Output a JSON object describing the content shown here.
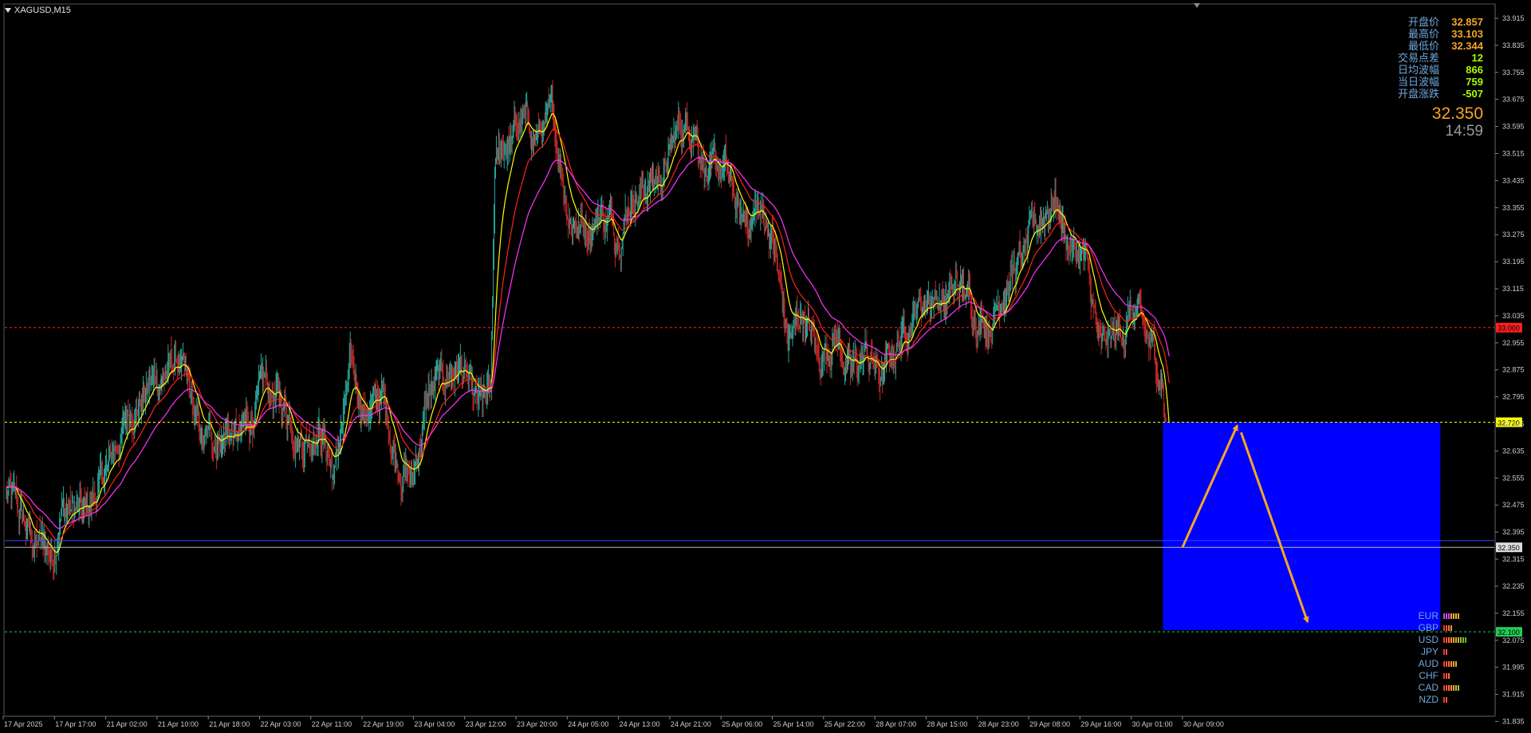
{
  "window": {
    "symbol_label": "XAGUSD,M15"
  },
  "info_panel": {
    "rows": [
      {
        "label": "开盘价",
        "value": "32.857",
        "color": "#f5a623"
      },
      {
        "label": "最高价",
        "value": "33.103",
        "color": "#f5a623"
      },
      {
        "label": "最低价",
        "value": "32.344",
        "color": "#f5a623"
      },
      {
        "label": "交易点差",
        "value": "12",
        "color": "#aaff00"
      },
      {
        "label": "日均波幅",
        "value": "866",
        "color": "#aaff00"
      },
      {
        "label": "当日波幅",
        "value": "759",
        "color": "#aaff00"
      },
      {
        "label": "开盘涨跌",
        "value": "-507",
        "color": "#aaff00"
      }
    ],
    "current_price": "32.350",
    "bar_timer": "14:59"
  },
  "currency_strength": [
    {
      "currency": "EUR",
      "level": 7,
      "max": 10
    },
    {
      "currency": "GBP",
      "level": 4,
      "max": 10
    },
    {
      "currency": "USD",
      "level": 10,
      "max": 10
    },
    {
      "currency": "JPY",
      "level": 2,
      "max": 10
    },
    {
      "currency": "AUD",
      "level": 6,
      "max": 10
    },
    {
      "currency": "CHF",
      "level": 3,
      "max": 10
    },
    {
      "currency": "CAD",
      "level": 7,
      "max": 10
    },
    {
      "currency": "NZD",
      "level": 2,
      "max": 10
    }
  ],
  "colors": {
    "background": "#000000",
    "bull": "#26a69a",
    "bear": "#c62828",
    "ma_fast": "#ffff00",
    "ma_mid": "#ff2020",
    "ma_slow": "#ff33ff",
    "zone": "#0000ff",
    "arrow": "#f5a623",
    "grid_text": "#cccccc"
  },
  "chart_data": {
    "type": "candlestick",
    "symbol": "XAGUSD",
    "timeframe": "M15",
    "ylim": [
      31.855,
      33.955
    ],
    "y_ticks": [
      "33.915",
      "33.835",
      "33.755",
      "33.675",
      "33.595",
      "33.515",
      "33.435",
      "33.355",
      "33.275",
      "33.195",
      "33.115",
      "33.035",
      "32.955",
      "32.875",
      "32.795",
      "32.715",
      "32.635",
      "32.555",
      "32.475",
      "32.395",
      "32.315",
      "32.235",
      "32.155",
      "32.075",
      "31.995",
      "31.915",
      "31.835"
    ],
    "x_ticks": [
      "17 Apr 2025",
      "17 Apr 17:00",
      "21 Apr 02:00",
      "21 Apr 10:00",
      "21 Apr 18:00",
      "22 Apr 03:00",
      "22 Apr 11:00",
      "22 Apr 19:00",
      "23 Apr 04:00",
      "23 Apr 12:00",
      "23 Apr 20:00",
      "24 Apr 05:00",
      "24 Apr 13:00",
      "24 Apr 21:00",
      "25 Apr 06:00",
      "25 Apr 14:00",
      "25 Apr 22:00",
      "28 Apr 07:00",
      "28 Apr 15:00",
      "28 Apr 23:00",
      "29 Apr 08:00",
      "29 Apr 16:00",
      "30 Apr 01:00",
      "30 Apr 09:00"
    ],
    "price_path": [
      [
        0,
        32.52
      ],
      [
        30,
        32.38
      ],
      [
        60,
        32.33
      ],
      [
        70,
        32.48
      ],
      [
        100,
        32.44
      ],
      [
        130,
        32.58
      ],
      [
        160,
        32.76
      ],
      [
        190,
        32.84
      ],
      [
        220,
        32.9
      ],
      [
        250,
        32.65
      ],
      [
        280,
        32.7
      ],
      [
        300,
        32.66
      ],
      [
        330,
        32.82
      ],
      [
        360,
        32.75
      ],
      [
        380,
        32.68
      ],
      [
        400,
        32.72
      ],
      [
        420,
        32.57
      ],
      [
        440,
        32.86
      ],
      [
        460,
        32.75
      ],
      [
        480,
        32.8
      ],
      [
        500,
        32.62
      ],
      [
        520,
        32.55
      ],
      [
        540,
        32.8
      ],
      [
        560,
        32.84
      ],
      [
        580,
        32.9
      ],
      [
        600,
        32.75
      ],
      [
        620,
        32.78
      ],
      [
        625,
        33.45
      ],
      [
        640,
        33.55
      ],
      [
        660,
        33.6
      ],
      [
        680,
        33.57
      ],
      [
        700,
        33.6
      ],
      [
        720,
        33.35
      ],
      [
        740,
        33.3
      ],
      [
        760,
        33.35
      ],
      [
        780,
        33.28
      ],
      [
        800,
        33.4
      ],
      [
        820,
        33.42
      ],
      [
        840,
        33.45
      ],
      [
        860,
        33.58
      ],
      [
        880,
        33.62
      ],
      [
        900,
        33.43
      ],
      [
        920,
        33.47
      ],
      [
        940,
        33.3
      ],
      [
        960,
        33.35
      ],
      [
        980,
        33.28
      ],
      [
        1000,
        32.95
      ],
      [
        1020,
        33.05
      ],
      [
        1040,
        32.9
      ],
      [
        1060,
        33.0
      ],
      [
        1080,
        32.85
      ],
      [
        1100,
        32.92
      ],
      [
        1120,
        32.85
      ],
      [
        1140,
        32.95
      ],
      [
        1160,
        33.05
      ],
      [
        1180,
        33.1
      ],
      [
        1200,
        33.08
      ],
      [
        1220,
        33.12
      ],
      [
        1240,
        33.05
      ],
      [
        1260,
        33.02
      ],
      [
        1280,
        33.15
      ],
      [
        1300,
        33.2
      ],
      [
        1320,
        33.3
      ],
      [
        1340,
        33.4
      ],
      [
        1360,
        33.25
      ],
      [
        1380,
        33.2
      ],
      [
        1400,
        32.92
      ],
      [
        1420,
        32.97
      ],
      [
        1440,
        33.05
      ],
      [
        1460,
        32.95
      ],
      [
        1480,
        32.85
      ],
      [
        1490,
        32.33
      ]
    ],
    "horizontal_levels": [
      {
        "price": 33.0,
        "label": "33.000",
        "style": "dashed",
        "color": "#ff2020",
        "tag_bg": "#ff2020"
      },
      {
        "price": 32.72,
        "label": "32.720",
        "style": "dashed",
        "color": "#ffff00",
        "tag_bg": "#ffff00"
      },
      {
        "price": 32.37,
        "label": "",
        "style": "solid",
        "color": "#3344ff",
        "tag_bg": ""
      },
      {
        "price": 32.35,
        "label": "32.350",
        "style": "solid",
        "color": "#bbbbbb",
        "tag_bg": "#dddddd"
      },
      {
        "price": 32.1,
        "label": "32.100",
        "style": "dashed",
        "color": "#22cc55",
        "tag_bg": "#22cc55"
      }
    ],
    "zone": {
      "from_index": 1480,
      "to_index": 1835,
      "top": 32.72,
      "bottom": 32.105
    },
    "projection_arrows": [
      {
        "from_index": 1505,
        "from_price": 32.35,
        "to_index": 1575,
        "to_price": 32.71
      },
      {
        "from_index": 1580,
        "from_price": 32.69,
        "to_index": 1665,
        "to_price": 32.13
      }
    ]
  }
}
